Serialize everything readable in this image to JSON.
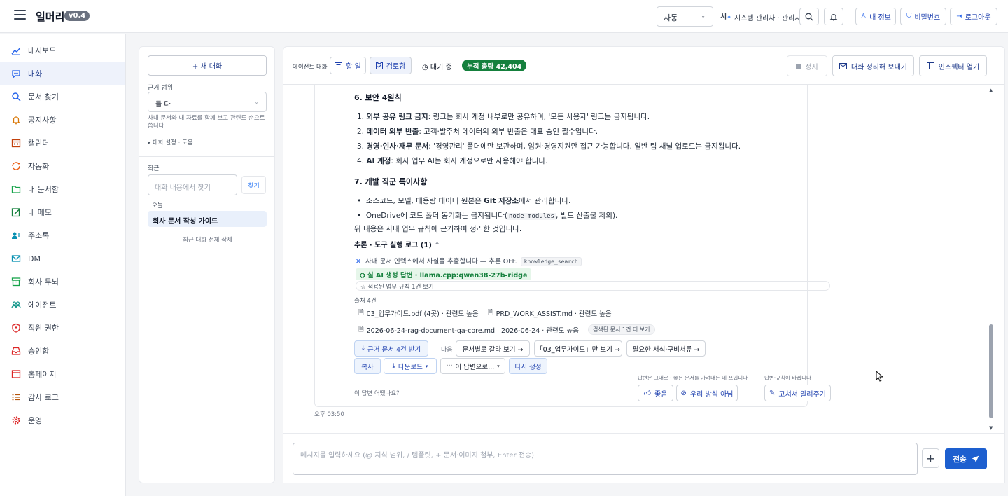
{
  "app": {
    "name": "일머리",
    "version": "v0.4"
  },
  "topbar": {
    "mode_value": "자동",
    "user_logo": "시",
    "user_name": "시스템 관리자 · 관리자",
    "my_info": "내 정보",
    "password": "비밀번호",
    "logout": "로그아웃"
  },
  "sidebar": {
    "items": [
      {
        "label": "대시보드",
        "icon": "chart-line-icon"
      },
      {
        "label": "대화",
        "icon": "chat-icon",
        "active": true
      },
      {
        "label": "문서 찾기",
        "icon": "search-icon"
      },
      {
        "label": "공지사항",
        "icon": "bell-icon"
      },
      {
        "label": "캘린더",
        "icon": "calendar-icon"
      },
      {
        "label": "자동화",
        "icon": "refresh-icon"
      },
      {
        "label": "내 문서함",
        "icon": "folder-icon"
      },
      {
        "label": "내 메모",
        "icon": "edit-icon"
      },
      {
        "label": "주소록",
        "icon": "contacts-icon"
      },
      {
        "label": "DM",
        "icon": "mail-icon"
      },
      {
        "label": "회사 두뇌",
        "icon": "archive-icon"
      },
      {
        "label": "에이전트",
        "icon": "users-icon"
      },
      {
        "label": "직원 권한",
        "icon": "shield-icon"
      },
      {
        "label": "승인함",
        "icon": "inbox-icon"
      },
      {
        "label": "홈페이지",
        "icon": "browser-icon"
      },
      {
        "label": "감사 로그",
        "icon": "list-icon"
      },
      {
        "label": "운영",
        "icon": "gear-icon"
      }
    ]
  },
  "left_panel": {
    "new_chat": "+ 새 대화",
    "scope_label": "근거 범위",
    "scope_value": "둘 다",
    "scope_help": "사내 문서와 내 자료를 함께 보고 관련도 순으로 씁니다",
    "settings": "▸ 대화 설정 · 도움",
    "recent_label": "최근",
    "search_placeholder": "대화 내용에서 찾기",
    "search_button": "찾기",
    "today_label": "오늘",
    "recent_item": "회사 문서 작성 가이드",
    "delete_all": "최근 대화 전체 삭제"
  },
  "main_header": {
    "title": "에이전트 대화",
    "tab_todo": "할 일",
    "tab_review": "검토함",
    "status": "대기 중",
    "tokens": "누적 총량 42,404",
    "stop": "정지",
    "send_summary": "대화 정리해 보내기",
    "open_inspector": "인스펙터 열기"
  },
  "message": {
    "section6_title": "6. 보안 4원칙",
    "s6": [
      {
        "n": "1.",
        "bold": "외부 공유 링크 금지",
        "text": ": 링크는 회사 계정 내부로만 공유하며, '모든 사용자' 링크는 금지됩니다."
      },
      {
        "n": "2.",
        "bold": "데이터 외부 반출",
        "text": ": 고객·발주처 데이터의 외부 반출은 대표 승인 필수입니다."
      },
      {
        "n": "3.",
        "bold": "경영·인사·재무 문서",
        "text": ": '경영관리' 폴더에만 보관하며, 임원·경영지원만 접근 가능합니다. 일반 팀 채널 업로드는 금지됩니다."
      },
      {
        "n": "4.",
        "bold": "AI 계정",
        "text": ": 회사 업무 AI는 회사 계정으로만 사용해야 합니다."
      }
    ],
    "section7_title": "7. 개발 직군 특이사항",
    "s7_1_pre": "소스코드, 모델, 대용량 데이터 원본은 ",
    "s7_1_bold": "Git 저장소",
    "s7_1_post": "에서 관리합니다.",
    "s7_2_pre": "OneDrive에 코드 폴더 동기화는 금지됩니다(",
    "s7_2_code": "node_modules",
    "s7_2_post": ", 빌드 산출물 제외).",
    "closing": "위 내용은 사내 업무 규칙에 근거하여 정리한 것입니다.",
    "tool_log_label": "추론 · 도구 실행 로그 (1)",
    "tool_text": "사내 문서 인덱스에서 사실을 추출합니다 — 추론 OFF.",
    "tool_tag": "knowledge_search",
    "model": "실 AI 생성 답변 · llama.cpp:qwen38-27b-ridge",
    "rules": "☆ 적용된 업무 규칙 1건 보기",
    "sources_label": "출처 4건",
    "sources": [
      "03_업무가이드.pdf (4곳) · 관련도 높음",
      "PRD_WORK_ASSIST.md · 관련도 높음",
      "2026-06-24-rag-document-qa-core.md · 2026-06-24 · 관련도 높음"
    ],
    "sources_more": "검색된 문서 1건 더 보기",
    "btn_evidence": "근거 문서 4건 받기",
    "next_label": "다음",
    "btn_by_doc": "문서별로 갈라 보기 →",
    "btn_guide_only": "「03_업무가이드」만 보기 →",
    "btn_forms": "필요한 서식·구비서류 →",
    "btn_copy": "복사",
    "btn_download": "다운로드",
    "btn_this_answer": "이 답변으로...",
    "btn_regen": "다시 생성",
    "feedback_hint1": "답변은 그대로 · 좋은 문서를 가려내는 데 쓰입니다",
    "feedback_hint2": "답변·규칙이 바뀝니다",
    "ask": "이 답변 어땠나요?",
    "btn_good": "좋음",
    "btn_not_our_way": "우리 방식 아님",
    "btn_teach": "고쳐서 알려주기",
    "time": "오후 03:50"
  },
  "composer": {
    "placeholder": "메시지를 입력하세요 (@ 지식 범위, / 템플릿, + 문서·이미지 첨부, Enter 전송)",
    "send": "전송"
  },
  "colors": {
    "accent": "#1d5fcf",
    "success": "#15803d",
    "active_bg": "#eef2fb"
  }
}
